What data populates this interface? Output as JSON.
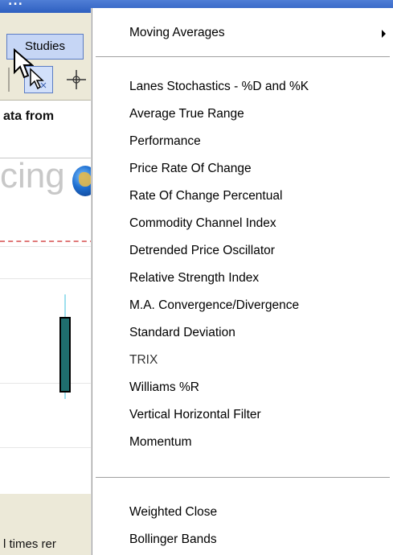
{
  "window": {
    "title_fragment": "...",
    "menubar": {
      "studies_label": "Studies"
    },
    "data_label": "ata from",
    "logo_fragment": "cing",
    "lower_label": "l times rer"
  },
  "menu": {
    "items": [
      {
        "label": "Moving Averages",
        "submenu": true
      },
      {
        "label": "Lanes Stochastics - %D and %K"
      },
      {
        "label": "Average True Range"
      },
      {
        "label": "Performance"
      },
      {
        "label": "Price Rate Of Change"
      },
      {
        "label": "Rate Of Change Percentual"
      },
      {
        "label": "Commodity Channel Index"
      },
      {
        "label": "Detrended Price Oscillator"
      },
      {
        "label": "Relative Strength Index"
      },
      {
        "label": "M.A. Convergence/Divergence"
      },
      {
        "label": "Standard Deviation"
      },
      {
        "label": "TRIX"
      },
      {
        "label": "Williams %R"
      },
      {
        "label": "Vertical Horizontal Filter"
      },
      {
        "label": "Momentum"
      },
      {
        "label": "Weighted Close"
      },
      {
        "label": "Bollinger Bands"
      }
    ]
  },
  "colors": {
    "menu_background": "#ffffff",
    "title_bar": "#2e5fc0",
    "candle_body": "#1f6e6e",
    "dashed_line": "#e07a7a"
  }
}
